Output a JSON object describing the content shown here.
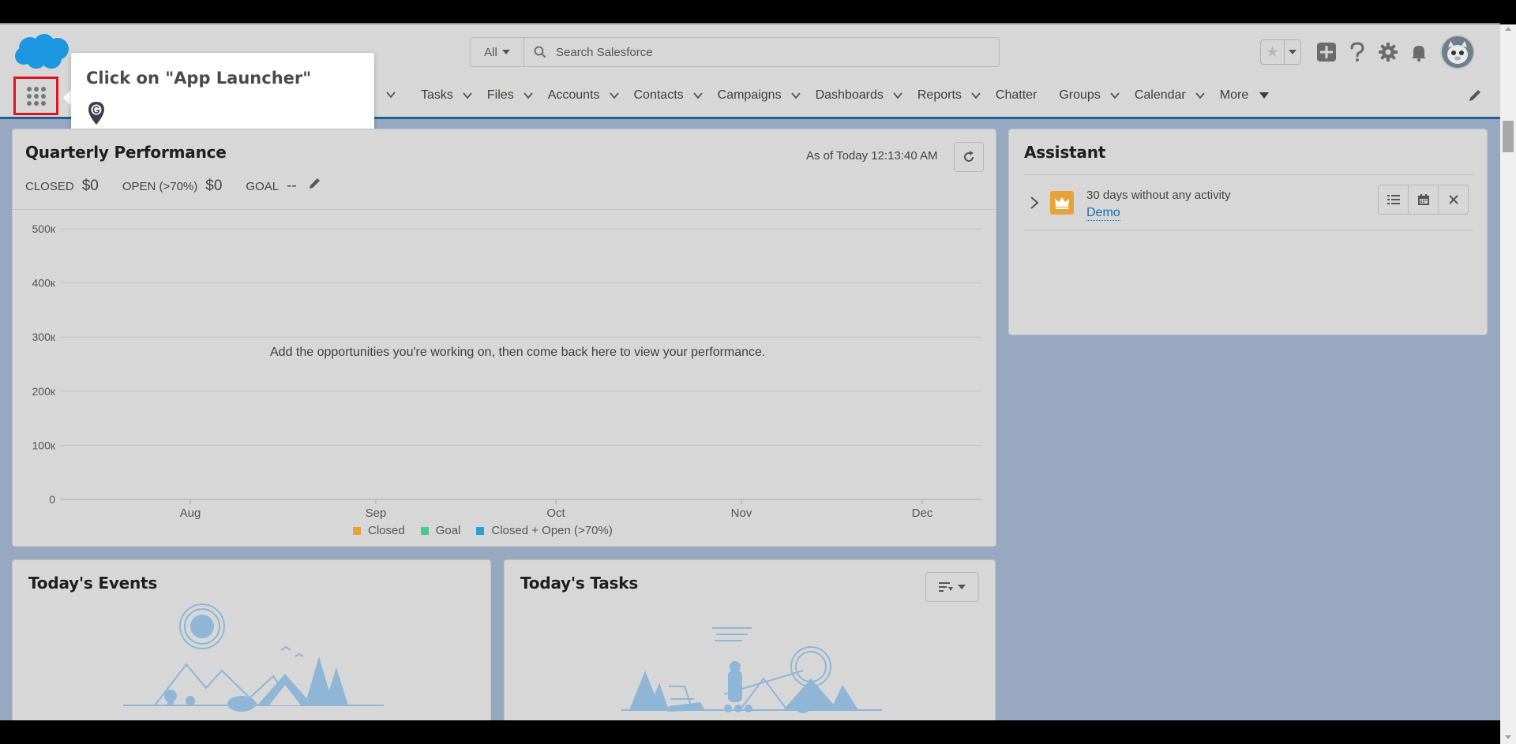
{
  "header": {
    "search_scope": "All",
    "search_placeholder": "Search Salesforce"
  },
  "nav": {
    "items": [
      {
        "label": "Tasks",
        "has_chevron": true
      },
      {
        "label": "Files",
        "has_chevron": true
      },
      {
        "label": "Accounts",
        "has_chevron": true
      },
      {
        "label": "Contacts",
        "has_chevron": true
      },
      {
        "label": "Campaigns",
        "has_chevron": true
      },
      {
        "label": "Dashboards",
        "has_chevron": true
      },
      {
        "label": "Reports",
        "has_chevron": true
      },
      {
        "label": "Chatter",
        "has_chevron": false
      },
      {
        "label": "Groups",
        "has_chevron": true
      },
      {
        "label": "Calendar",
        "has_chevron": true
      }
    ],
    "more_label": "More"
  },
  "callout": {
    "title": "Click on \"App Launcher\""
  },
  "quarterly": {
    "title": "Quarterly Performance",
    "closed_label": "CLOSED",
    "closed_value": "$0",
    "open_label": "OPEN (>70%)",
    "open_value": "$0",
    "goal_label": "GOAL",
    "goal_value": "--",
    "as_of": "As of Today 12:13:40 AM",
    "empty_message": "Add the opportunities you're working on, then come back here to view your performance."
  },
  "chart_data": {
    "type": "line",
    "categories": [
      "Aug",
      "Sep",
      "Oct",
      "Nov",
      "Dec"
    ],
    "y_ticks": [
      "0",
      "100к",
      "200к",
      "300к",
      "400к",
      "500к"
    ],
    "ylim": [
      0,
      500000
    ],
    "series": [
      {
        "name": "Closed",
        "color": "#e8a23a",
        "values": []
      },
      {
        "name": "Goal",
        "color": "#4bca81",
        "values": []
      },
      {
        "name": "Closed + Open (>70%)",
        "color": "#2e9fd3",
        "values": []
      }
    ],
    "grid": true,
    "legend_position": "bottom"
  },
  "assistant": {
    "title": "Assistant",
    "item_text": "30 days without any activity",
    "item_link": "Demo"
  },
  "events": {
    "title": "Today's Events"
  },
  "tasks": {
    "title": "Today's Tasks"
  },
  "colors": {
    "brand_blue": "#1b96e0",
    "highlight_red": "#e0141e",
    "link_blue": "#1b6bb5"
  }
}
